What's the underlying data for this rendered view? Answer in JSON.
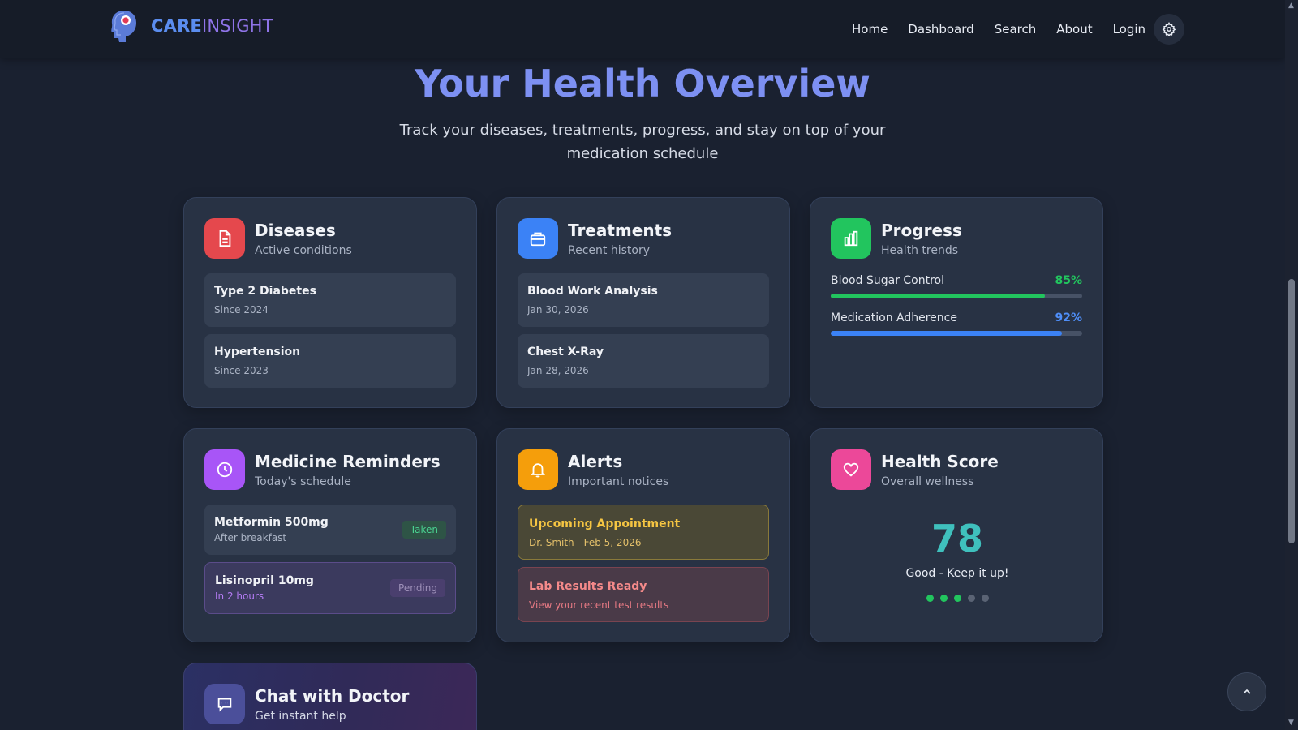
{
  "brand": {
    "part1": "CARE",
    "part2": "INSIGHT"
  },
  "nav": {
    "links": [
      "Home",
      "Dashboard",
      "Search",
      "About",
      "Login"
    ],
    "settings_icon": "gear-icon"
  },
  "hero": {
    "title": "Your Health Overview",
    "subtitle": "Track your diseases, treatments, progress, and stay on top of your medication schedule"
  },
  "diseases": {
    "title": "Diseases",
    "subtitle": "Active conditions",
    "icon": "document-icon",
    "color": "#e5484d",
    "items": [
      {
        "name": "Type 2 Diabetes",
        "since": "Since 2024"
      },
      {
        "name": "Hypertension",
        "since": "Since 2023"
      }
    ]
  },
  "treatments": {
    "title": "Treatments",
    "subtitle": "Recent history",
    "icon": "briefcase-icon",
    "color": "#3b82f6",
    "items": [
      {
        "name": "Blood Work Analysis",
        "date": "Jan 30, 2026"
      },
      {
        "name": "Chest X-Ray",
        "date": "Jan 28, 2026"
      }
    ]
  },
  "progress": {
    "title": "Progress",
    "subtitle": "Health trends",
    "icon": "bar-chart-icon",
    "color": "#22c55e",
    "metrics": [
      {
        "label": "Blood Sugar Control",
        "value": "85%",
        "fraction": 0.85,
        "color": "#22c55e"
      },
      {
        "label": "Medication Adherence",
        "value": "92%",
        "fraction": 0.92,
        "color": "#3b82f6"
      }
    ]
  },
  "reminders": {
    "title": "Medicine Reminders",
    "subtitle": "Today's schedule",
    "icon": "clock-icon",
    "color": "#a855f7",
    "items": [
      {
        "name": "Metformin 500mg",
        "note": "After breakfast",
        "status": "Taken"
      },
      {
        "name": "Lisinopril 10mg",
        "note": "In 2 hours",
        "status": "Pending"
      }
    ]
  },
  "alerts": {
    "title": "Alerts",
    "subtitle": "Important notices",
    "icon": "bell-icon",
    "color": "#f59e0b",
    "items": [
      {
        "title": "Upcoming Appointment",
        "detail": "Dr. Smith - Feb 5, 2026"
      },
      {
        "title": "Lab Results Ready",
        "detail": "View your recent test results"
      }
    ]
  },
  "health_score": {
    "title": "Health Score",
    "subtitle": "Overall wellness",
    "icon": "heart-icon",
    "color": "#ec4899",
    "score": "78",
    "label": "Good - Keep it up!",
    "rating": 3,
    "rating_max": 5
  },
  "chat": {
    "title": "Chat with Doctor",
    "subtitle": "Get instant help",
    "icon": "chat-bubble-icon"
  },
  "scroll_top_icon": "chevron-up-icon"
}
